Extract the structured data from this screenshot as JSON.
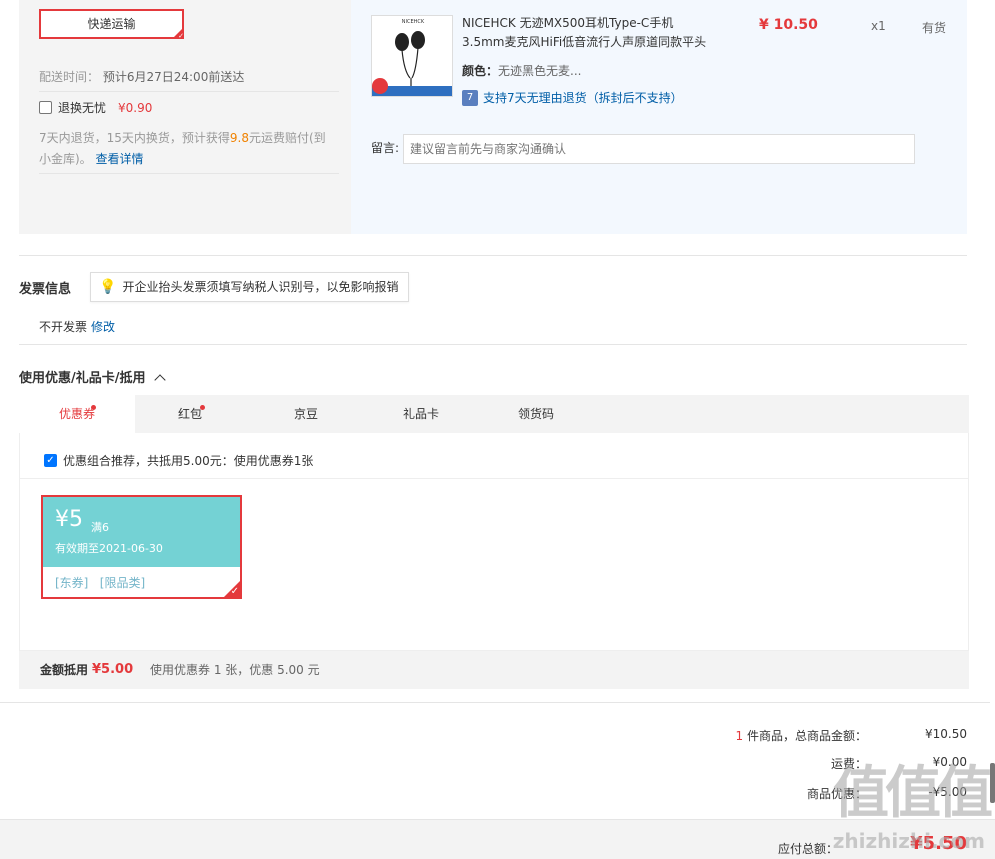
{
  "shipping": {
    "express_label": "快递运输",
    "delivery_label": "配送时间：",
    "delivery_value": "预计6月27日24:00前送达",
    "return_label": "退换无忧",
    "return_price": "¥0.90",
    "return_desc_a": "7天内退货，15天内换货，预计获得",
    "return_desc_amount": "9.8",
    "return_desc_b": "元运费赔付(到小金库)。",
    "return_link": "查看详情"
  },
  "product": {
    "image_brand": "NICEHCK",
    "title": "NICEHCK 无迹MX500耳机Type-C手机3.5mm麦克风HiFi低音流行人声原道同款平头塞 无迹",
    "color_label": "颜色：",
    "color_value": "无迹黑色无麦...",
    "support_icon": "7",
    "support_text": "支持7天无理由退货（拆封后不支持）",
    "price": "¥ 10.50",
    "qty": "x1",
    "stock": "有货",
    "remark_label": "留言:",
    "remark_placeholder": "建议留言前先与商家沟通确认"
  },
  "invoice": {
    "title": "发票信息",
    "tip": "开企业抬头发票须填写纳税人识别号，以免影响报销",
    "status": "不开发票",
    "modify_link": "修改"
  },
  "coupons": {
    "title": "使用优惠/礼品卡/抵用",
    "tabs": [
      {
        "label": "优惠券"
      },
      {
        "label": "红包"
      },
      {
        "label": "京豆"
      },
      {
        "label": "礼品卡"
      },
      {
        "label": "领货码"
      }
    ],
    "recommend_text": "优惠组合推荐，共抵用5.00元：使用优惠券1张",
    "coupon": {
      "amount": "¥5",
      "condition": "满6",
      "valid": "有效期至2021-06-30",
      "tags": "[东券]   [限品类]"
    },
    "footer_label": "金额抵用",
    "footer_amount": "¥5.00",
    "footer_desc": "使用优惠券 1 张，优惠 5.00 元"
  },
  "summary": {
    "count": "1",
    "items_label": " 件商品，总商品金额：",
    "items_value": "¥10.50",
    "shipping_label": "运费：",
    "shipping_value": "¥0.00",
    "discount_label": "商品优惠：",
    "discount_value": "-¥5.00",
    "total_label": "应付总额：",
    "total_value": "¥5.50"
  },
  "watermark": {
    "logo": "值值值",
    "url": "zhizhizhi.com"
  }
}
